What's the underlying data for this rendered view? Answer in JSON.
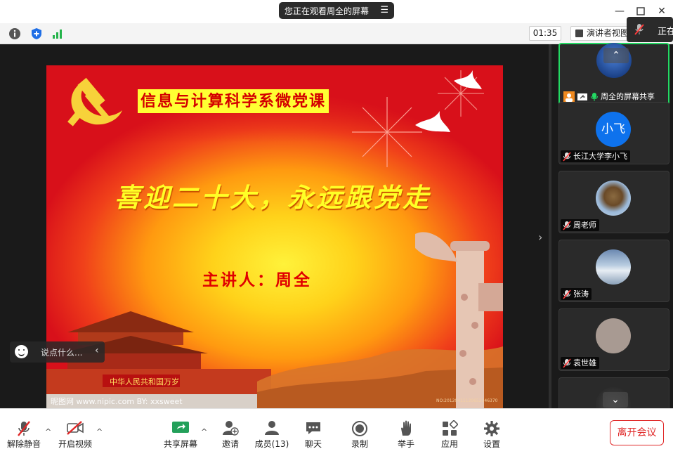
{
  "share_banner": {
    "text": "您正在观看周全的屏幕",
    "icon": "menu-icon"
  },
  "infobar": {
    "timer": "01:35",
    "view_label": "演讲者视图",
    "speaking_label": "正在"
  },
  "slide": {
    "course_title": "信息与计算科学系微党课",
    "headline": "喜迎二十大，永远跟党走",
    "speaker": "主讲人：周全",
    "watermark_left": "昵图网 www.nipic.com   BY: xxsweet",
    "watermark_right": "NO:20120411120652346370"
  },
  "chat": {
    "placeholder": "说点什么..."
  },
  "participants": [
    {
      "name": "周全的屏幕共享",
      "active": true,
      "avatar": "photo"
    },
    {
      "name": "长江大学李小飞",
      "avatar_text": "小飞"
    },
    {
      "name": "周老师",
      "avatar": "eagle-photo"
    },
    {
      "name": "张涛",
      "avatar": "sky-photo"
    },
    {
      "name": "袁世雄",
      "avatar": "gray-photo"
    }
  ],
  "toolbar": {
    "unmute": "解除静音",
    "start_video": "开启视频",
    "share_screen": "共享屏幕",
    "invite": "邀请",
    "participants": "成员(13)",
    "chat": "聊天",
    "record": "录制",
    "raise_hand": "举手",
    "apps": "应用",
    "settings": "设置",
    "leave": "离开会议"
  },
  "colors": {
    "accent_green": "#23d963",
    "leave_red": "#e02828",
    "zoom_blue": "#0e72ed"
  }
}
